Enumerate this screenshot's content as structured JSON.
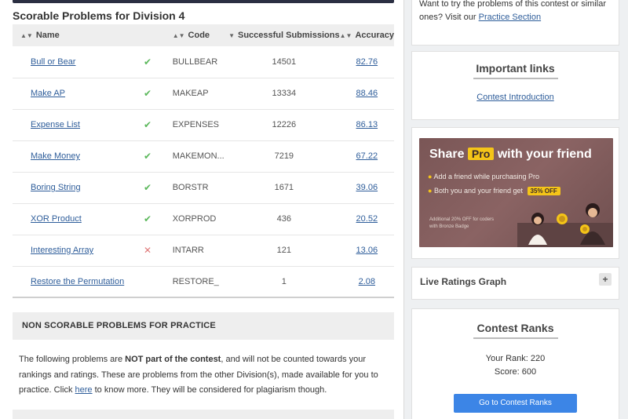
{
  "scorable": {
    "title": "Scorable Problems for Division 4",
    "columns": {
      "name": "Name",
      "code": "Code",
      "submissions": "Successful Submissions",
      "accuracy": "Accuracy"
    },
    "rows": [
      {
        "name": "Bull or Bear",
        "status": "solved",
        "code": "BULLBEAR",
        "submissions": "14501",
        "accuracy": "82.76"
      },
      {
        "name": "Make AP",
        "status": "solved",
        "code": "MAKEAP",
        "submissions": "13334",
        "accuracy": "88.46"
      },
      {
        "name": "Expense List",
        "status": "solved",
        "code": "EXPENSES",
        "submissions": "12226",
        "accuracy": "86.13"
      },
      {
        "name": "Make Money",
        "status": "solved",
        "code": "MAKEMON...",
        "submissions": "7219",
        "accuracy": "67.22"
      },
      {
        "name": "Boring String",
        "status": "solved",
        "code": "BORSTR",
        "submissions": "1671",
        "accuracy": "39.06"
      },
      {
        "name": "XOR Product",
        "status": "solved",
        "code": "XORPROD",
        "submissions": "436",
        "accuracy": "20.52"
      },
      {
        "name": "Interesting Array",
        "status": "wrong",
        "code": "INTARR",
        "submissions": "121",
        "accuracy": "13.06"
      },
      {
        "name": "Restore the Permutation",
        "status": "none",
        "code": "RESTORE_",
        "submissions": "1",
        "accuracy": "2.08"
      }
    ],
    "status_icons": {
      "solved": "✔",
      "wrong": "✕",
      "none": ""
    }
  },
  "non_scorable": {
    "title": "NON SCORABLE PROBLEMS FOR PRACTICE",
    "text_1": "The following problems are ",
    "text_bold": "NOT part of the contest",
    "text_2": ", and will not be counted towards your rankings and ratings. These are problems from the other Division(s), made available for you to practice. Click ",
    "here_link": "here",
    "text_3": " to know more. They will be considered for plagiarism though."
  },
  "sidebar": {
    "practice_text": "Want to try the problems of this contest or similar ones? Visit our ",
    "practice_link": "Practice Section",
    "important_links_title": "Important links",
    "contest_intro_link": "Contest Introduction",
    "promo": {
      "share": "Share",
      "pro": "Pro",
      "with_friend": "with your friend",
      "bullet_1": "Add a friend while purchasing Pro",
      "bullet_2": "Both you and your friend get",
      "discount": "35% OFF",
      "fine_print_1": "Additional 20% OFF for coders",
      "fine_print_2": "with Bronze Badge"
    },
    "live_ratings_title": "Live Ratings Graph",
    "plus_icon": "+",
    "contest_ranks_title": "Contest Ranks",
    "your_rank": "Your Rank: 220",
    "score": "Score: 600",
    "ranks_button": "Go to Contest Ranks"
  }
}
